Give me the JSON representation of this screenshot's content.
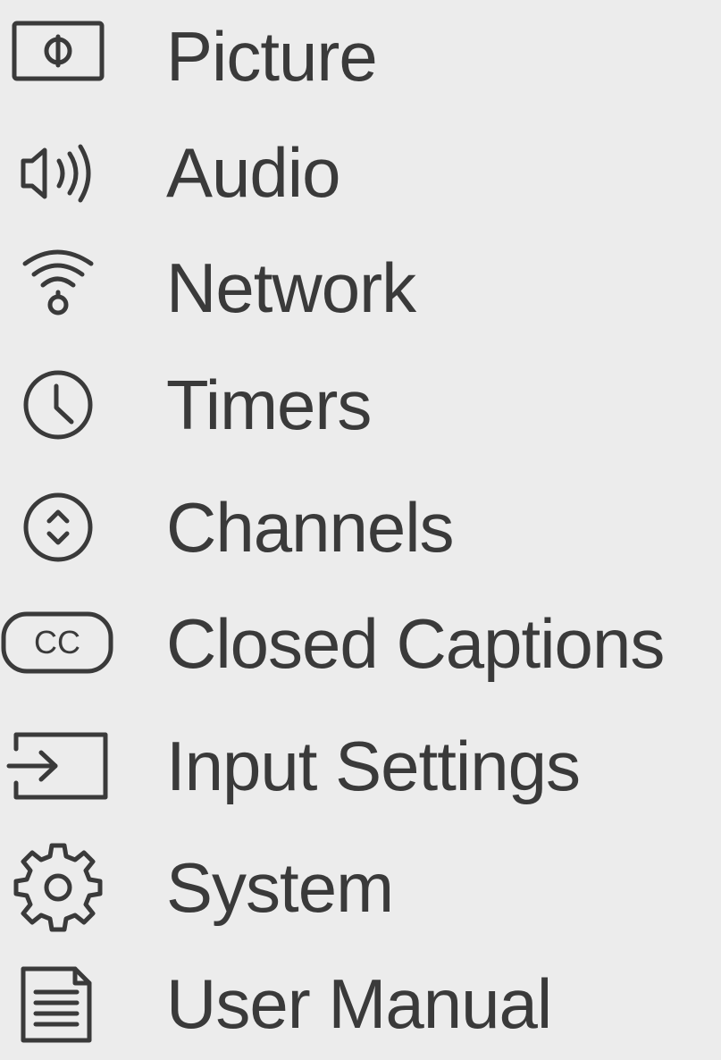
{
  "menu": {
    "items": [
      {
        "label": "Picture",
        "icon": "picture-icon"
      },
      {
        "label": "Audio",
        "icon": "speaker-icon"
      },
      {
        "label": "Network",
        "icon": "wifi-icon"
      },
      {
        "label": "Timers",
        "icon": "clock-icon"
      },
      {
        "label": "Channels",
        "icon": "channels-icon"
      },
      {
        "label": "Closed Captions",
        "icon": "cc-icon"
      },
      {
        "label": "Input Settings",
        "icon": "input-icon"
      },
      {
        "label": "System",
        "icon": "gear-icon"
      },
      {
        "label": "User Manual",
        "icon": "document-icon"
      }
    ]
  },
  "colors": {
    "background": "#ececec",
    "text": "#3a3a3a"
  }
}
